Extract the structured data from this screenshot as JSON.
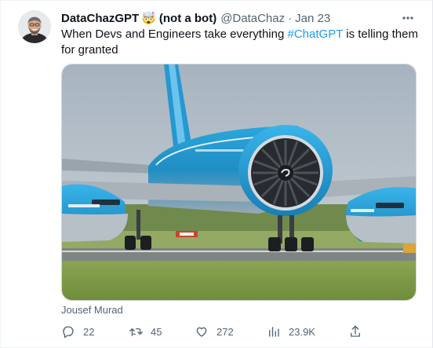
{
  "tweet": {
    "display_name": "DataChazGPT",
    "emoji": "🤯",
    "name_suffix": "(not a bot)",
    "handle": "@DataChaz",
    "separator": "·",
    "date": "Jan 23",
    "text_before": "When Devs and Engineers take everything ",
    "hashtag": "#ChatGPT",
    "text_after": " is telling them for granted",
    "media_caption": "Jousef Murad",
    "more_icon": "more-horizontal-icon"
  },
  "actions": {
    "reply_count": "22",
    "retweet_count": "45",
    "like_count": "272",
    "views_count": "23.9K"
  },
  "colors": {
    "link": "#1d9bf0",
    "secondary_text": "#536471",
    "primary_text": "#0f1419",
    "klm_blue": "#1ba3df"
  }
}
